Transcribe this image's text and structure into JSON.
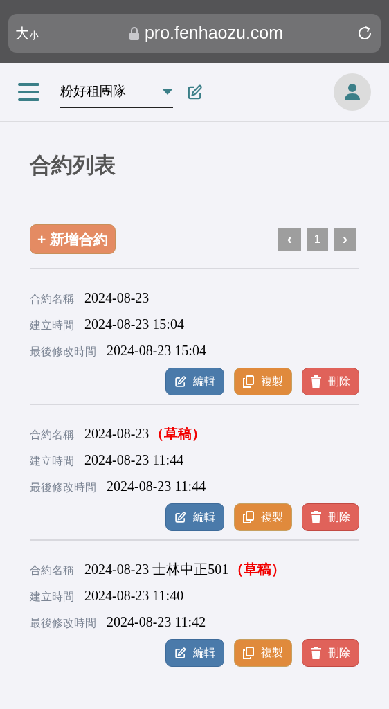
{
  "browser": {
    "text_size": "大",
    "text_size_small": "小",
    "url": "pro.fenhaozu.com"
  },
  "header": {
    "team": "粉好租團隊"
  },
  "page": {
    "title": "合約列表",
    "add_button": "+ 新增合約",
    "pagination": {
      "prev": "‹",
      "page": "1",
      "next": "›"
    }
  },
  "contracts": [
    {
      "fields": [
        {
          "label": "合約名稱",
          "value": "2024-08-23"
        },
        {
          "label": "建立時間",
          "value": "2024-08-23 15:04"
        },
        {
          "label": "最後修改時間",
          "value": "2024-08-23 15:04"
        }
      ],
      "actions": [
        {
          "kind": "edit",
          "label": "編輯"
        },
        {
          "kind": "copy",
          "label": "複製"
        },
        {
          "kind": "delete",
          "label": "刪除"
        }
      ]
    },
    {
      "fields": [
        {
          "label": "合約名稱",
          "value": "2024-08-23"
        },
        {
          "label": "建立時間",
          "value": "2024-08-23 11:44"
        },
        {
          "label": "最後修改時間",
          "value": "2024-08-23 11:44"
        }
      ],
      "draft_tag": "（草稿）",
      "actions": [
        {
          "kind": "edit",
          "label": "編輯"
        },
        {
          "kind": "copy",
          "label": "複製"
        },
        {
          "kind": "delete",
          "label": "刪除"
        }
      ]
    },
    {
      "fields": [
        {
          "label": "合約名稱",
          "value": "2024-08-23 士林中正501"
        },
        {
          "label": "建立時間",
          "value": "2024-08-23 11:40"
        },
        {
          "label": "最後修改時間",
          "value": "2024-08-23 11:42"
        }
      ],
      "draft_tag": "（草稿）",
      "actions": [
        {
          "kind": "edit",
          "label": "編輯"
        },
        {
          "kind": "copy",
          "label": "複製"
        },
        {
          "kind": "delete",
          "label": "刪除"
        }
      ]
    }
  ]
}
